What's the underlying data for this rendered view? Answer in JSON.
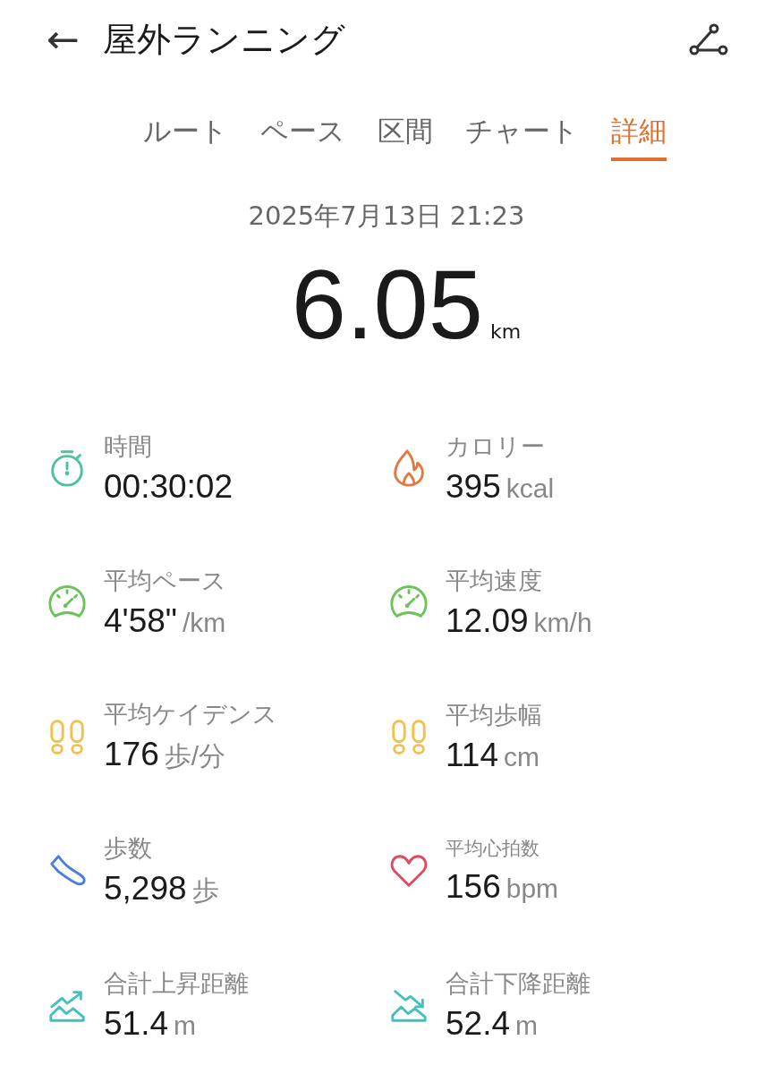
{
  "header": {
    "back": "←",
    "title": "屋外ランニング"
  },
  "tabs": [
    {
      "label": "ルート",
      "selected": false
    },
    {
      "label": "ペース",
      "selected": false
    },
    {
      "label": "区間",
      "selected": false
    },
    {
      "label": "チャート",
      "selected": false
    },
    {
      "label": "詳細",
      "selected": true
    }
  ],
  "summary": {
    "date": "2025年7月13日 21:23",
    "distance": "6.05",
    "unit": "km"
  },
  "metrics": [
    {
      "kind": "stopwatch",
      "color": "#4cc29a",
      "label": "時間",
      "value": "00:30:02",
      "compact_label": false
    },
    {
      "kind": "flame",
      "color": "#e07840",
      "label": "カロリー",
      "value": "395",
      "unit": "kcal",
      "compact_label": false
    },
    {
      "kind": "gauge",
      "color": "#6cc35a",
      "label": "平均ペース",
      "value": "4'58\"",
      "unit": "/km",
      "compact_label": false
    },
    {
      "kind": "gauge",
      "color": "#6cc35a",
      "label": "平均速度",
      "value": "12.09",
      "unit": "km/h",
      "compact_label": false
    },
    {
      "kind": "footprints",
      "color": "#f0c050",
      "label": "平均ケイデンス",
      "value": "176",
      "unit": "歩/分",
      "compact_label": false
    },
    {
      "kind": "footprints",
      "color": "#f0c050",
      "label": "平均歩幅",
      "value": "114",
      "unit": "cm",
      "compact_label": false
    },
    {
      "kind": "shoe",
      "color": "#4a7de0",
      "label": "歩数",
      "value": "5,298",
      "unit": "歩",
      "compact_label": false
    },
    {
      "kind": "heart",
      "color": "#e04a60",
      "label": "平均心拍数",
      "value": "156",
      "unit": "bpm",
      "compact_label": true
    },
    {
      "kind": "ascent",
      "color": "#45c0c0",
      "label": "合計上昇距離",
      "value": "51.4",
      "unit": "m",
      "compact_label": false
    },
    {
      "kind": "descent",
      "color": "#45c0c0",
      "label": "合計下降距離",
      "value": "52.4",
      "unit": "m",
      "compact_label": false
    }
  ]
}
